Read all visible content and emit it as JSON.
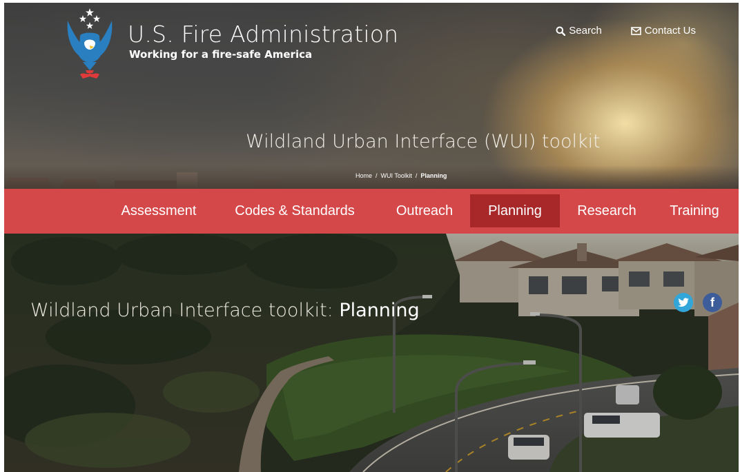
{
  "header": {
    "brand_name": "U.S. Fire Administration",
    "tagline": "Working for a fire-safe America",
    "logo_icon": "eagle-stars-icon",
    "links": [
      {
        "label": "Search",
        "icon": "search-icon"
      },
      {
        "label": "Contact Us",
        "icon": "envelope-icon"
      }
    ]
  },
  "section_title": "Wildland Urban Interface (WUI) toolkit",
  "breadcrumb": {
    "items": [
      "Home",
      "WUI Toolkit"
    ],
    "separator": "/",
    "current": "Planning"
  },
  "nav": {
    "items": [
      {
        "label": "Assessment"
      },
      {
        "label": "Codes & Standards"
      },
      {
        "label": "Outreach"
      },
      {
        "label": "Planning",
        "active": true
      },
      {
        "label": "Research"
      },
      {
        "label": "Training"
      }
    ]
  },
  "hero": {
    "title_prefix": "Wildland Urban Interface toolkit: ",
    "title_highlight": "Planning",
    "social": [
      {
        "name": "twitter",
        "glyph": "❧",
        "icon": "twitter-icon",
        "color": "#32a6d8"
      },
      {
        "name": "facebook",
        "glyph": "f",
        "icon": "facebook-icon",
        "color": "#3c5d9a"
      }
    ]
  },
  "colors": {
    "nav_background": "#d5484a",
    "nav_active": "#a8282a",
    "logo_blue": "#2a7fc0",
    "logo_red": "#e03a3a"
  }
}
